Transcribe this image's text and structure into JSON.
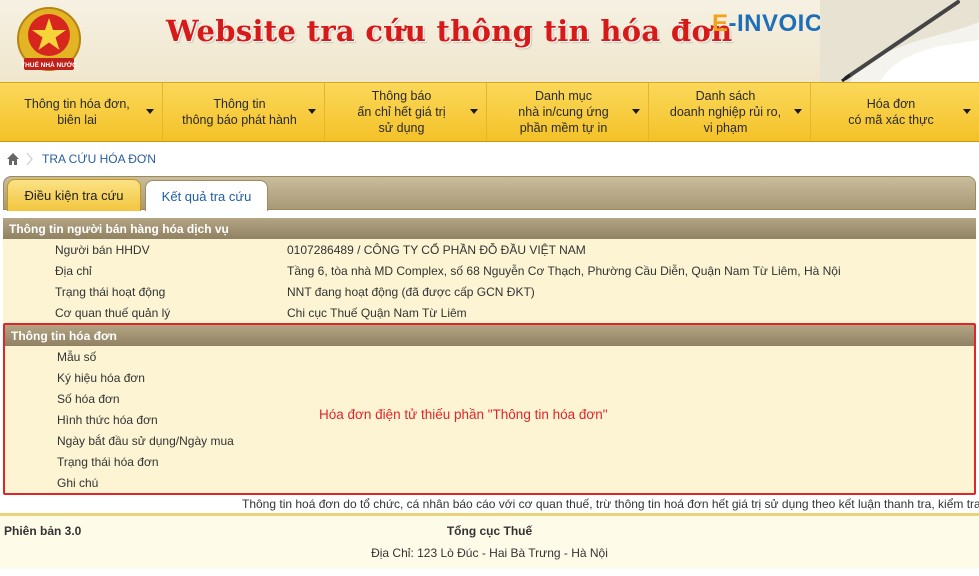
{
  "banner": {
    "emblem_text": "THUẾ NHÀ NƯỚC",
    "site_title": "Website tra cứu thông tin hóa đơn",
    "brand_e": "E",
    "brand_rest": "-INVOICE"
  },
  "menu": {
    "items": [
      {
        "label": "Thông tin hóa đơn,\nbiên lai"
      },
      {
        "label": "Thông tin\nthông báo phát hành"
      },
      {
        "label": "Thông báo\nấn chỉ hết giá trị\nsử dụng"
      },
      {
        "label": "Danh mục\nnhà in/cung ứng\nphần mềm tự in"
      },
      {
        "label": "Danh sách\ndoanh nghiệp rủi ro,\nvi phạm"
      },
      {
        "label": "Hóa đơn\ncó mã xác thực"
      }
    ]
  },
  "breadcrumb": {
    "current": "TRA CỨU HÓA ĐƠN"
  },
  "tabs": {
    "items": [
      {
        "label": "Điều kiện tra cứu"
      },
      {
        "label": "Kết quả tra cứu"
      }
    ]
  },
  "seller": {
    "header": "Thông tin người bán hàng hóa dịch vụ",
    "rows": [
      {
        "label": "Người bán HHDV",
        "value": "0107286489 / CÔNG TY CỔ PHẦN ĐỖ ĐẦU VIỆT NAM"
      },
      {
        "label": "Địa chỉ",
        "value": "Tầng 6, tòa nhà MD Complex, số 68 Nguyễn Cơ Thạch, Phường Cầu Diễn, Quận Nam Từ Liêm, Hà Nội"
      },
      {
        "label": "Trạng thái hoạt động",
        "value": "NNT đang hoạt động (đã được cấp GCN ĐKT)"
      },
      {
        "label": "Cơ quan thuế quản lý",
        "value": "Chi cục Thuế Quận Nam Từ Liêm"
      }
    ]
  },
  "invoice": {
    "header": "Thông tin hóa đơn",
    "rows": [
      {
        "label": "Mẫu số"
      },
      {
        "label": "Ký hiệu hóa đơn"
      },
      {
        "label": "Số hóa đơn"
      },
      {
        "label": "Hình thức hóa đơn"
      },
      {
        "label": "Ngày bắt đầu sử dụng/Ngày mua"
      },
      {
        "label": "Trạng thái hóa đơn"
      },
      {
        "label": "Ghi chú"
      }
    ],
    "warning": "Hóa đơn điện tử thiếu phần \"Thông tin hóa đơn\""
  },
  "notice": "Thông tin hoá đơn do tổ chức, cá nhân báo cáo với cơ quan thuế, trừ thông tin hoá đơn hết giá trị sử dụng theo kết luận thanh tra, kiểm tra",
  "footer": {
    "version": "Phiên bản 3.0",
    "org": "Tổng cục Thuế",
    "address": "Địa Chỉ: 123 Lò Đúc - Hai Bà Trưng - Hà Nội"
  },
  "colors": {
    "menu_bg": "#f4c228",
    "title_red": "#d61a1a",
    "section_header": "#a0916f",
    "row_bg": "#fcf4d3",
    "warning_red": "#e0262b",
    "link_blue": "#1f5fa8"
  }
}
